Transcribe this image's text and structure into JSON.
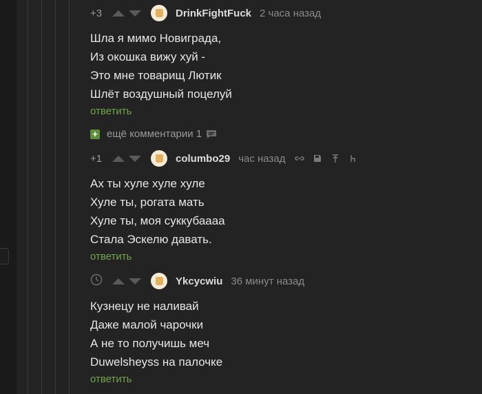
{
  "colors": {
    "background": "#232323",
    "reply_link": "#72a44a",
    "more_badge": "#5f8f3c"
  },
  "comments": [
    {
      "rating": "+3",
      "author": "DrinkFightFuck",
      "time": "2 часа назад",
      "lines": [
        "Шла я мимо Новиграда,",
        "Из окошка вижу хуй -",
        "Это мне товарищ Лютик",
        "Шлёт воздушный поцелуй"
      ],
      "reply_label": "ответить"
    },
    {
      "rating": "+1",
      "author": "columbo29",
      "time": "час назад",
      "tool_icons": [
        "link-icon",
        "save-icon",
        "arrow-up-icon",
        "more-icon"
      ],
      "lines": [
        "Ах ты хуле хуле хуле",
        "Хуле ты, рогата мать",
        "Хуле ты, моя суккубаааа",
        "Стала Эскелю давать."
      ],
      "reply_label": "ответить"
    },
    {
      "rating_icon": "clock-icon",
      "author": "Ykcycwiu",
      "time": "36 минут назад",
      "lines": [
        "Кузнецу не наливай",
        "Даже малой чарочки",
        "А не то получишь меч",
        "Duwelsheyss на палочке"
      ],
      "reply_label": "ответить"
    }
  ],
  "more_comments": {
    "label": "ещё комментарии 1",
    "icon": "chat-icon"
  }
}
